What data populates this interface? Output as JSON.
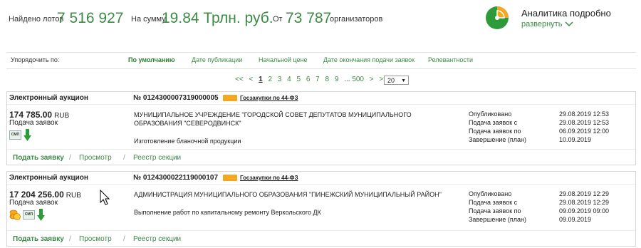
{
  "stats": {
    "found_label": "Найдено лотов",
    "found_value": "7 516 927",
    "sum_label": "На сумму",
    "sum_value": "19.84 Трлн. руб.",
    "from_label": "От",
    "orgs_value": "73 787",
    "orgs_label": "организаторов"
  },
  "analytics": {
    "title": "Аналитика подробно",
    "expand_label": "развернуть",
    "pie_color_main": "#2e9b3a",
    "pie_color_accent": "#f5a623",
    "icon": "pie-chart-icon"
  },
  "sort": {
    "label": "Упорядочить по:",
    "options": [
      "По умолчанию",
      "Дате публикации",
      "Начальной цене",
      "Дате окончания подачи заявок",
      "Релевантности"
    ]
  },
  "pager": {
    "first": "<<",
    "prev": "<",
    "pages": [
      "1",
      "2",
      "3",
      "4",
      "5",
      "6",
      "7",
      "8",
      "9"
    ],
    "ellipsis": "...",
    "last_page": "500",
    "next": ">",
    "last": ">>",
    "per_page": "20"
  },
  "lots": [
    {
      "type": "Электронный аукцион",
      "number": "№ 0124300007319000005",
      "law": "Госзакупки по 44-ФЗ",
      "price": "174 785.00",
      "currency": "RUB",
      "stage": "Подача заявок",
      "customer": "МУНИЦИПАЛЬНОЕ УЧРЕЖДЕНИЕ \"ГОРОДСКОЙ СОВЕТ ДЕПУТАТОВ МУНИЦИПАЛЬНОГО ОБРАЗОВАНИЯ \"СЕВЕРОДВИНСК\"",
      "subject": "Изготовление бланочной продукции",
      "dates": [
        {
          "label": "Опубликовано",
          "value": "29.08.2019 12:53"
        },
        {
          "label": "Подача заявок с",
          "value": "29.08.2019 12:53"
        },
        {
          "label": "Подача заявок по",
          "value": "06.09.2019 12:00"
        },
        {
          "label": "Завершение (план)",
          "value": "10.09.2019"
        }
      ],
      "smp_label": "СМП",
      "actions": {
        "apply": "Подать заявку",
        "view": "Просмотр",
        "registry": "Реестр секции",
        "sep": "/"
      }
    },
    {
      "type": "Электронный аукцион",
      "number": "№ 0124300022119000107",
      "law": "Госзакупки по 44-ФЗ",
      "price": "17 204 256.00",
      "currency": "RUB",
      "stage": "Подача заявок",
      "customer": "АДМИНИСТРАЦИЯ МУНИЦИПАЛЬНОГО ОБРАЗОВАНИЯ \"ПИНЕЖСКИЙ МУНИЦИПАЛЬНЫЙ РАЙОН\"",
      "subject": "Выполнение работ по капитальному ремонту Веркольского ДК",
      "dates": [
        {
          "label": "Опубликовано",
          "value": "29.08.2019 12:29"
        },
        {
          "label": "Подача заявок с",
          "value": "29.08.2019 12:29"
        },
        {
          "label": "Подача заявок по",
          "value": "09.09.2019 09:00"
        },
        {
          "label": "Завершение (план)",
          "value": "09.09.2019"
        }
      ],
      "smp_label": "СМП",
      "actions": {
        "apply": "Подать заявку",
        "view": "Просмотр",
        "registry": "Реестр секции",
        "sep": "/"
      }
    }
  ]
}
